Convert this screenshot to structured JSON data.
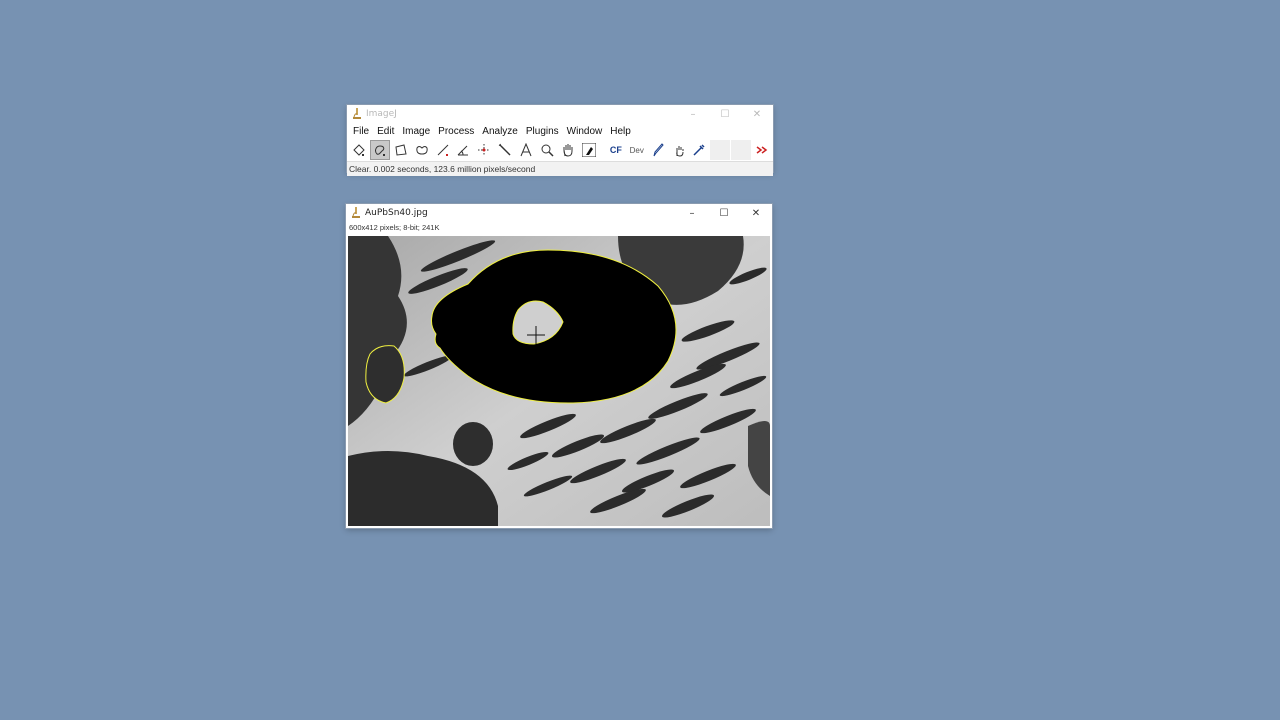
{
  "imagej": {
    "title": "ImageJ",
    "menu": [
      "File",
      "Edit",
      "Image",
      "Process",
      "Analyze",
      "Plugins",
      "Window",
      "Help"
    ],
    "tools": [
      {
        "name": "rectangle-tool-icon"
      },
      {
        "name": "freehand-tool-icon",
        "selected": true
      },
      {
        "name": "polygon-tool-icon"
      },
      {
        "name": "oval-tool-icon"
      },
      {
        "name": "line-tool-icon"
      },
      {
        "name": "angle-tool-icon"
      },
      {
        "name": "point-tool-icon"
      },
      {
        "name": "wand-tool-icon"
      },
      {
        "name": "text-tool-icon"
      },
      {
        "name": "magnifier-tool-icon"
      },
      {
        "name": "hand-tool-icon"
      },
      {
        "name": "color-picker-tool-icon"
      },
      {
        "name": "cf-tool",
        "label": "CF"
      },
      {
        "name": "dev-tool",
        "label": "Dev"
      },
      {
        "name": "brush-tool-icon"
      },
      {
        "name": "hand-pointer-tool-icon"
      },
      {
        "name": "pipette-tool-icon"
      },
      {
        "name": "empty-slot-1"
      },
      {
        "name": "empty-slot-2"
      },
      {
        "name": "more-tools-icon"
      }
    ],
    "status": "Clear. 0.002 seconds, 123.6 million pixels/second",
    "accent_red": "#cc2222"
  },
  "image_window": {
    "title": "AuPbSn40.jpg",
    "info": "600x412 pixels; 8-bit; 241K",
    "selection_color": "#f0f040"
  }
}
